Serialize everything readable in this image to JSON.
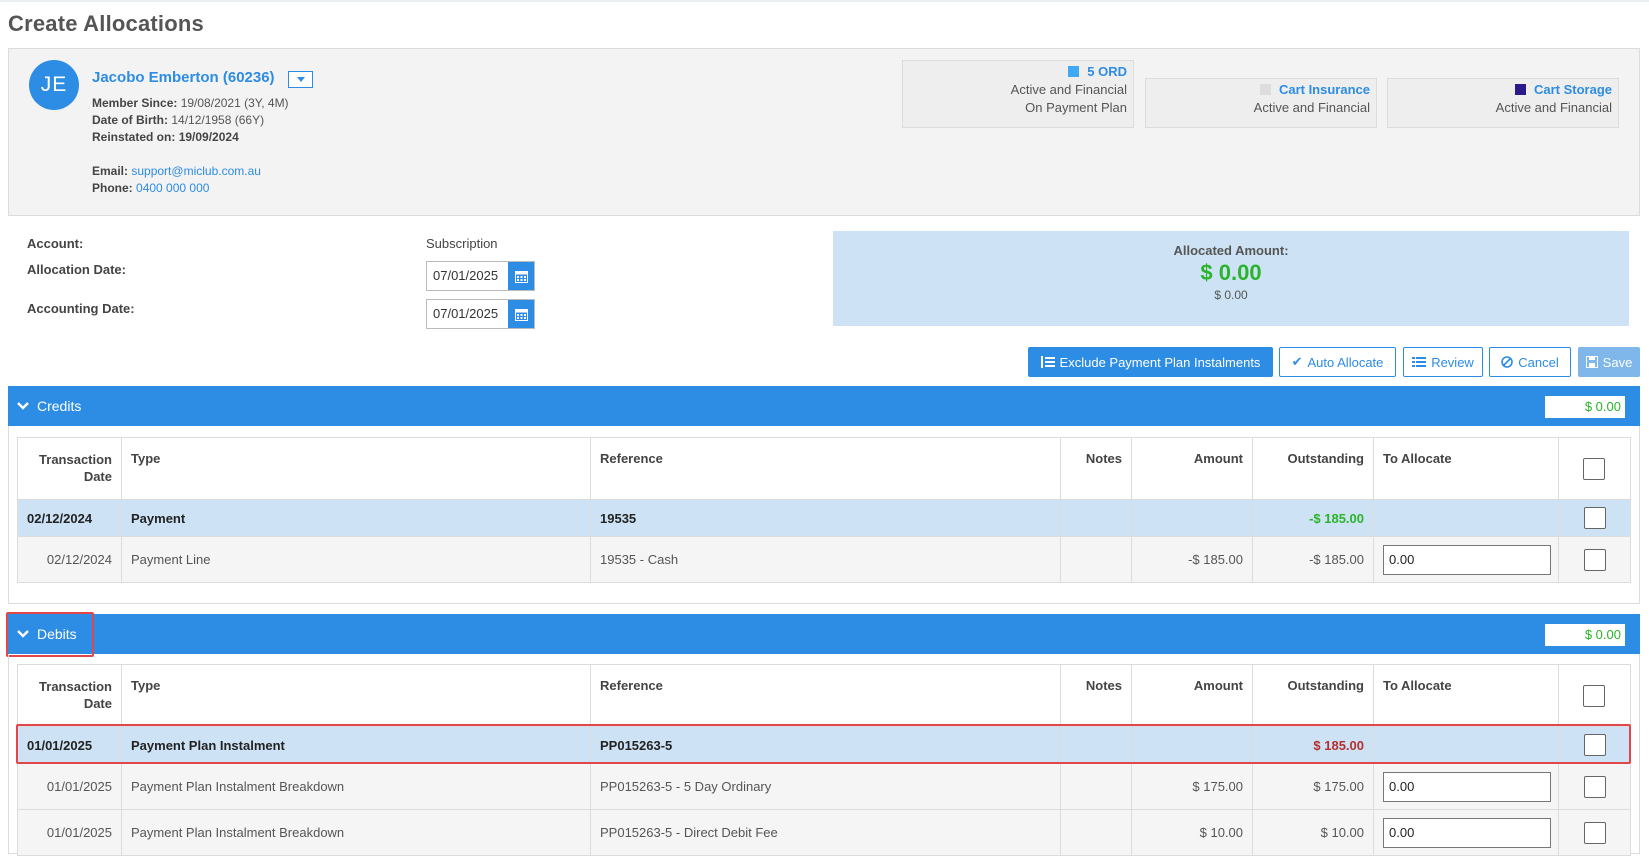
{
  "page": {
    "title": "Create Allocations"
  },
  "member": {
    "initials": "JE",
    "name": "Jacobo Emberton (60236)",
    "member_since_label": "Member Since:",
    "member_since_value": "19/08/2021 (3Y, 4M)",
    "dob_label": "Date of Birth:",
    "dob_value": "14/12/1958 (66Y)",
    "reinstated_label": "Reinstated on:",
    "reinstated_value": "19/09/2024",
    "email_label": "Email:",
    "email_value": "support@miclub.com.au",
    "phone_label": "Phone:",
    "phone_value": "0400 000 000"
  },
  "memberships": [
    {
      "name": "5 ORD",
      "line1": "Active and Financial",
      "line2": "On Payment Plan",
      "color": "#3fa9f5"
    },
    {
      "name": "Cart Insurance",
      "line1": "Active and Financial",
      "line2": "",
      "color": "#dddddd"
    },
    {
      "name": "Cart Storage",
      "line1": "Active and Financial",
      "line2": "",
      "color": "#2a1a8c"
    }
  ],
  "account": {
    "account_label": "Account:",
    "account_value": "Subscription",
    "allocation_date_label": "Allocation Date:",
    "allocation_date_value": "07/01/2025",
    "accounting_date_label": "Accounting Date:",
    "accounting_date_value": "07/01/2025"
  },
  "allocated": {
    "label": "Allocated Amount:",
    "amount": "$ 0.00",
    "sub": "$ 0.00"
  },
  "actions": {
    "exclude": "Exclude Payment Plan Instalments",
    "auto_allocate": "Auto Allocate",
    "review": "Review",
    "cancel": "Cancel",
    "save": "Save"
  },
  "columns": [
    "Transaction Date",
    "Type",
    "Reference",
    "Notes",
    "Amount",
    "Outstanding",
    "To Allocate"
  ],
  "credits": {
    "title": "Credits",
    "total": "$ 0.00",
    "parent": {
      "date": "02/12/2024",
      "type": "Payment",
      "reference": "19535",
      "notes": "",
      "amount": "",
      "outstanding": "-$ 185.00"
    },
    "lines": [
      {
        "date": "02/12/2024",
        "type": "Payment Line",
        "reference": "19535 - Cash",
        "notes": "",
        "amount": "-$ 185.00",
        "outstanding": "-$ 185.00",
        "to_allocate": "0.00"
      }
    ]
  },
  "debits": {
    "title": "Debits",
    "total": "$ 0.00",
    "parent": {
      "date": "01/01/2025",
      "type": "Payment Plan Instalment",
      "reference": "PP015263-5",
      "notes": "",
      "amount": "",
      "outstanding": "$ 185.00"
    },
    "lines": [
      {
        "date": "01/01/2025",
        "type": "Payment Plan Instalment Breakdown",
        "reference": "PP015263-5 - 5 Day Ordinary",
        "notes": "",
        "amount": "$ 175.00",
        "outstanding": "$ 175.00",
        "to_allocate": "0.00"
      },
      {
        "date": "01/01/2025",
        "type": "Payment Plan Instalment Breakdown",
        "reference": "PP015263-5 - Direct Debit Fee",
        "notes": "",
        "amount": "$ 10.00",
        "outstanding": "$ 10.00",
        "to_allocate": "0.00"
      }
    ]
  },
  "colors": {
    "primary": "#2d8ce3",
    "positive": "#2bb32b",
    "negative": "#b5302d",
    "highlight": "#e0474b"
  }
}
